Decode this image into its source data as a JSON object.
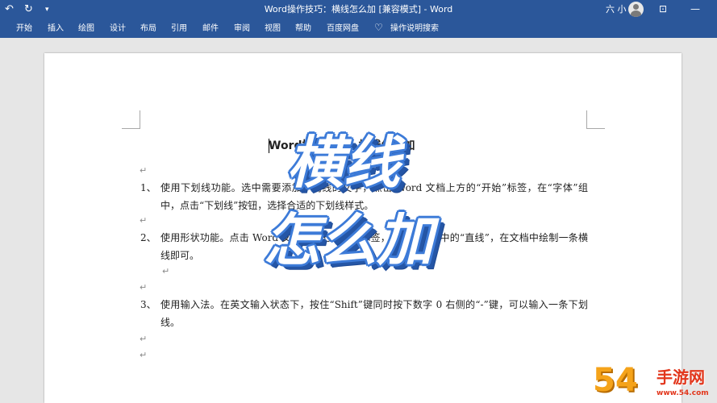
{
  "titlebar": {
    "window_title": "Word操作技巧：横线怎么加 [兼容模式] - Word",
    "user_name": "六 小",
    "undo_icon": "undo-icon",
    "redo_icon": "redo-icon",
    "customize_icon": "customize-toolbar-icon",
    "minimize": "—"
  },
  "ribbon": {
    "tabs": [
      "开始",
      "插入",
      "绘图",
      "设计",
      "布局",
      "引用",
      "邮件",
      "审阅",
      "视图",
      "帮助",
      "百度网盘"
    ],
    "tell_me": "操作说明搜索"
  },
  "document": {
    "title": "Word操作技巧：横线怎么加",
    "para_mark": "↵",
    "items": [
      {
        "num": "1、",
        "text": "使用下划线功能。选中需要添加下划线的文字，点击 Word 文档上方的“开始”标签，在“字体”组中，点击“下划线”按钮，选择合适的下划线样式。"
      },
      {
        "num": "2、",
        "text": "使用形状功能。点击 Word 文档上方的“插入”标签，选择“形状”中的“直线”，在文档中绘制一条横线即可。"
      },
      {
        "num": "3、",
        "text": "使用输入法。在英文输入状态下，按住“Shift”键同时按下数字 0 右侧的“-”键，可以输入一条下划线。"
      }
    ]
  },
  "overlay": {
    "line1": "横线",
    "line2": "怎么加"
  },
  "watermark": {
    "number": "54",
    "text": "手游网",
    "url": "www.54.com"
  },
  "colors": {
    "word_blue": "#2b579a",
    "overlay_blue": "#3d7bd8",
    "watermark_orange": "#f5a31a",
    "watermark_red": "#e2361c"
  }
}
